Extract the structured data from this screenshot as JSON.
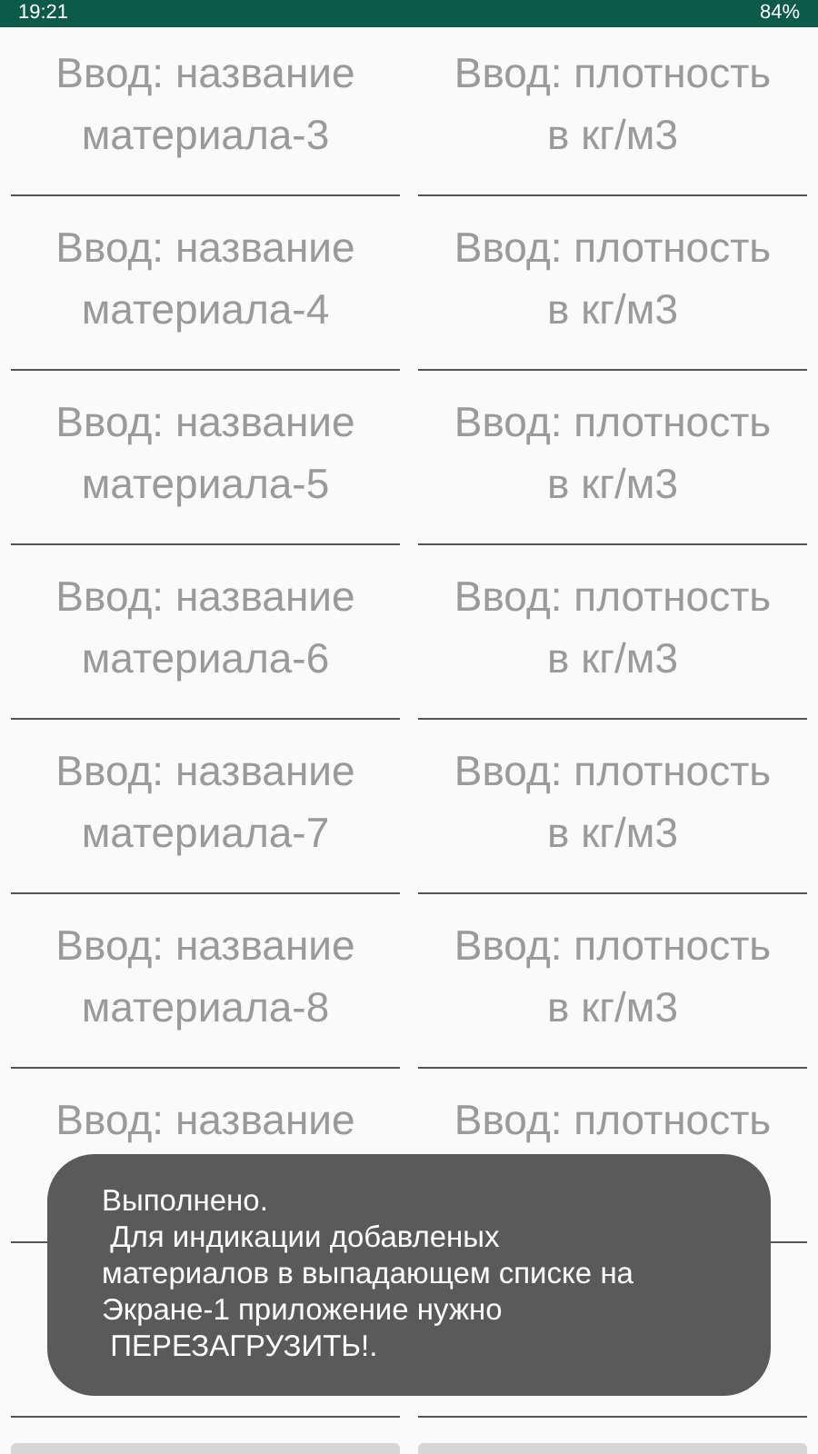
{
  "status_bar": {
    "time": "19:21",
    "battery": "84%"
  },
  "rows": [
    {
      "name": {
        "placeholder": "Ввод: название\nматериала-3"
      },
      "density": {
        "placeholder": "Ввод: плотность\nв кг/м3"
      }
    },
    {
      "name": {
        "placeholder": "Ввод: название\nматериала-4"
      },
      "density": {
        "placeholder": "Ввод: плотность\nв кг/м3"
      }
    },
    {
      "name": {
        "placeholder": "Ввод: название\nматериала-5"
      },
      "density": {
        "placeholder": "Ввод: плотность\nв кг/м3"
      }
    },
    {
      "name": {
        "placeholder": "Ввод: название\nматериала-6"
      },
      "density": {
        "placeholder": "Ввод: плотность\nв кг/м3"
      }
    },
    {
      "name": {
        "placeholder": "Ввод: название\nматериала-7"
      },
      "density": {
        "placeholder": "Ввод: плотность\nв кг/м3"
      }
    },
    {
      "name": {
        "placeholder": "Ввод: название\nматериала-8"
      },
      "density": {
        "placeholder": "Ввод: плотность\nв кг/м3"
      }
    },
    {
      "name": {
        "placeholder": "Ввод: название"
      },
      "density": {
        "placeholder": "Ввод: плотность"
      }
    },
    {}
  ],
  "toast": {
    "message": "Выполнено.\n Для индикации добавленых\nматериалов в выпадающем списке на\nЭкране-1 приложение нужно\n ПЕРЕЗАГРУЗИТЬ!."
  }
}
